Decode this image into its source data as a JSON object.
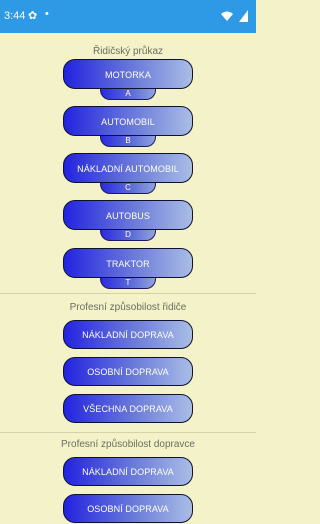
{
  "status": {
    "time": "3:44",
    "gear": "✿",
    "dot": "•"
  },
  "sections": {
    "license": {
      "title": "Řidičský průkaz",
      "buttons": [
        {
          "label": "MOTORKA",
          "tab": "A"
        },
        {
          "label": "AUTOMOBIL",
          "tab": "B"
        },
        {
          "label": "NÁKLADNÍ AUTOMOBIL",
          "tab": "C"
        },
        {
          "label": "AUTOBUS",
          "tab": "D"
        },
        {
          "label": "TRAKTOR",
          "tab": "T"
        }
      ]
    },
    "driver": {
      "title": "Profesní způsobilost řidiče",
      "buttons": [
        "NÁKLADNÍ DOPRAVA",
        "OSOBNÍ DOPRAVA",
        "VŠECHNA DOPRAVA"
      ]
    },
    "carrier": {
      "title": "Profesní způsobilost dopravce",
      "buttons": [
        "NÁKLADNÍ DOPRAVA",
        "OSOBNÍ DOPRAVA"
      ]
    }
  }
}
